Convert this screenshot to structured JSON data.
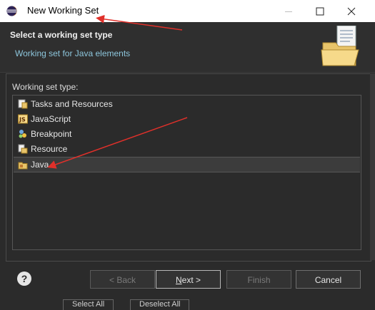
{
  "window": {
    "title": "New Working Set"
  },
  "header": {
    "title": "Select a working set type",
    "subtitle": "Working set for Java elements"
  },
  "main": {
    "label": "Working set type:",
    "items": [
      {
        "label": "Tasks and Resources",
        "icon": "tasks-resources-icon",
        "selected": false
      },
      {
        "label": "JavaScript",
        "icon": "javascript-icon",
        "selected": false
      },
      {
        "label": "Breakpoint",
        "icon": "breakpoint-icon",
        "selected": false
      },
      {
        "label": "Resource",
        "icon": "resource-icon",
        "selected": false
      },
      {
        "label": "Java",
        "icon": "java-package-icon",
        "selected": true
      }
    ]
  },
  "footer": {
    "help": "?",
    "back": "< Back",
    "next": "Next >",
    "finish": "Finish",
    "cancel": "Cancel"
  },
  "background": {
    "select_all": "Select All",
    "deselect_all": "Deselect All"
  },
  "colors": {
    "dialog_bg": "#2b2b2b",
    "subtitle": "#8dc6dc",
    "annotation_arrow": "#e0302a"
  }
}
